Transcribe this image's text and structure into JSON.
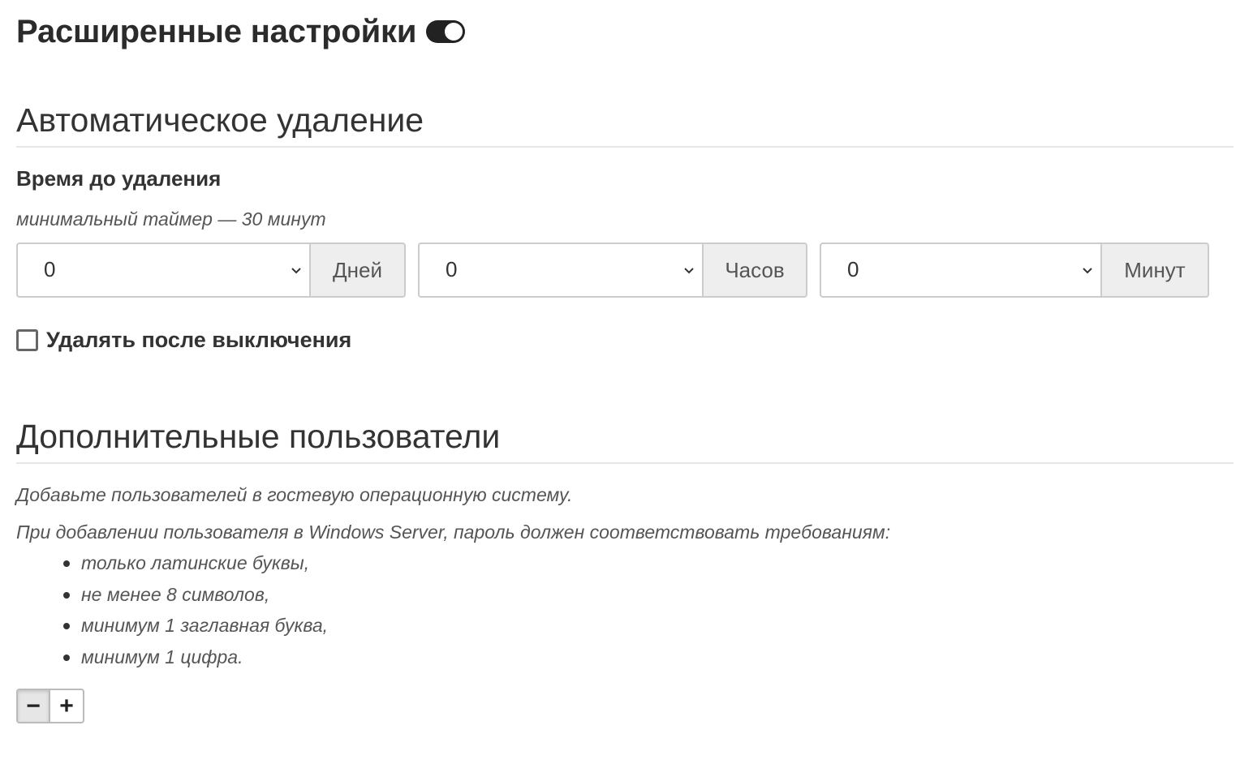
{
  "header": {
    "title": "Расширенные настройки",
    "toggle_on": true
  },
  "auto_delete": {
    "heading": "Автоматическое удаление",
    "time_label": "Время до удаления",
    "hint": "минимальный таймер — 30 минут",
    "days": {
      "value": "0",
      "unit": "Дней"
    },
    "hours": {
      "value": "0",
      "unit": "Часов"
    },
    "minutes": {
      "value": "0",
      "unit": "Минут"
    },
    "delete_after_shutdown": {
      "label": "Удалять после выключения",
      "checked": false
    }
  },
  "extra_users": {
    "heading": "Дополнительные пользователи",
    "description": "Добавьте пользователей в гостевую операционную систему.",
    "requirements_intro": "При добавлении пользователя в Windows Server, пароль должен соответствовать требованиям:",
    "requirements": [
      "только латинские буквы,",
      "не менее 8 символов,",
      "минимум 1 заглавная буква,",
      "минимум 1 цифра."
    ],
    "remove_label": "−",
    "add_label": "+"
  },
  "icons": {
    "toggle": "toggle-switch-icon",
    "chevron": "chevron-down-icon",
    "checkbox": "checkbox-icon"
  }
}
